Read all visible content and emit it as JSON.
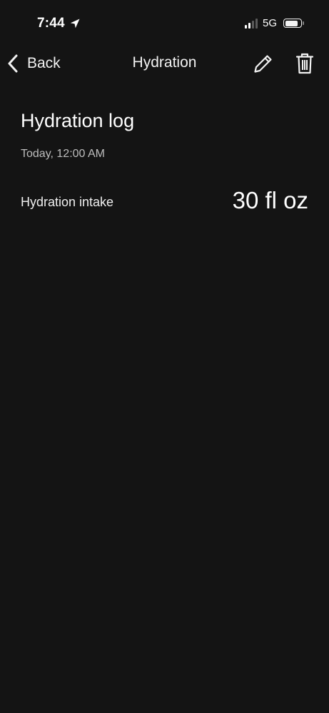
{
  "status_bar": {
    "time": "7:44",
    "network": "5G",
    "location_icon": "location-arrow-icon",
    "signal_icon": "cellular-signal-icon",
    "battery_icon": "battery-icon",
    "signal_bars_active": 2,
    "signal_bars_total": 4,
    "battery_level": 0.85
  },
  "nav": {
    "back_label": "Back",
    "title": "Hydration",
    "back_icon": "chevron-left-icon",
    "edit_icon": "pencil-icon",
    "delete_icon": "trash-icon"
  },
  "log": {
    "title": "Hydration log",
    "timestamp": "Today, 12:00 AM",
    "intake_label": "Hydration intake",
    "intake_value": "30 fl oz"
  },
  "colors": {
    "background": "#141414",
    "text_primary": "#ffffff",
    "text_secondary": "#bdbdbd"
  }
}
